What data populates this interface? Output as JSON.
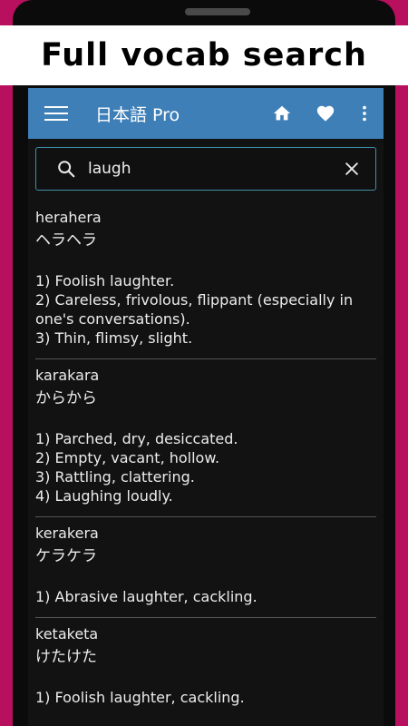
{
  "banner": {
    "text": "Full vocab search"
  },
  "appbar": {
    "title": "日本語 Pro",
    "icons": [
      "menu-icon",
      "home-icon",
      "heart-icon",
      "more-vert-icon"
    ]
  },
  "search": {
    "value": "laugh"
  },
  "results": [
    {
      "romaji": "herahera",
      "kana": "ヘラヘラ",
      "definitions": [
        "1) Foolish laughter.",
        "2) Careless, frivolous, flippant (especially in one's conversations).",
        "3) Thin, flimsy, slight."
      ]
    },
    {
      "romaji": "karakara",
      "kana": "からから",
      "definitions": [
        "1) Parched, dry, desiccated.",
        "2) Empty, vacant, hollow.",
        "3) Rattling, clattering.",
        "4) Laughing loudly."
      ]
    },
    {
      "romaji": "kerakera",
      "kana": "ケラケラ",
      "definitions": [
        "1) Abrasive laughter, cackling."
      ]
    },
    {
      "romaji": "ketaketa",
      "kana": "けたけた",
      "definitions": [
        "1) Foolish laughter, cackling."
      ]
    }
  ]
}
